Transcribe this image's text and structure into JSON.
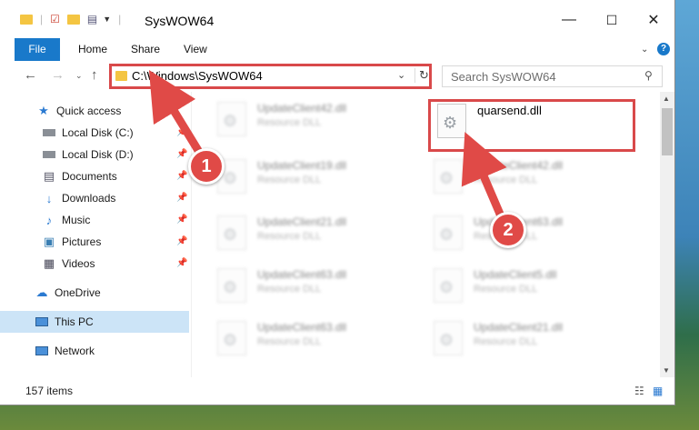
{
  "window": {
    "title": "SysWOW64",
    "caption": {
      "minimize": "—",
      "maximize": "☐",
      "close": "✕"
    }
  },
  "ribbon": {
    "tabs": [
      {
        "label": "File"
      },
      {
        "label": "Home"
      },
      {
        "label": "Share"
      },
      {
        "label": "View"
      }
    ],
    "help": "?"
  },
  "nav": {
    "address": "C:\\Windows\\SysWOW64",
    "search_placeholder": "Search SysWOW64"
  },
  "sidebar": {
    "items": [
      {
        "label": "Quick access",
        "icon": "star-icon",
        "pinned": false
      },
      {
        "label": "Local Disk (C:)",
        "icon": "drive-icon",
        "pinned": true
      },
      {
        "label": "Local Disk (D:)",
        "icon": "drive-icon",
        "pinned": true
      },
      {
        "label": "Documents",
        "icon": "documents-icon",
        "pinned": true
      },
      {
        "label": "Downloads",
        "icon": "download-icon",
        "pinned": true
      },
      {
        "label": "Music",
        "icon": "music-icon",
        "pinned": true
      },
      {
        "label": "Pictures",
        "icon": "pictures-icon",
        "pinned": true
      },
      {
        "label": "Videos",
        "icon": "videos-icon",
        "pinned": true
      },
      {
        "label": "OneDrive",
        "icon": "cloud-icon",
        "pinned": false
      },
      {
        "label": "This PC",
        "icon": "computer-icon",
        "pinned": false,
        "selected": true
      },
      {
        "label": "Network",
        "icon": "network-icon",
        "pinned": false
      }
    ]
  },
  "files": [
    {
      "name": "UpdateClient42.dll",
      "type": "Resource DLL"
    },
    {
      "name": "quarsend.dll",
      "type": ""
    },
    {
      "name": "UpdateClient19.dll",
      "type": "Resource DLL"
    },
    {
      "name": "UpdateClient42.dll",
      "type": "Resource DLL"
    },
    {
      "name": "UpdateClient21.dll",
      "type": "Resource DLL"
    },
    {
      "name": "UpdateClient63.dll",
      "type": "Resource DLL"
    },
    {
      "name": "UpdateClient63.dll",
      "type": "Resource DLL"
    },
    {
      "name": "UpdateClient5.dll",
      "type": "Resource DLL"
    },
    {
      "name": "UpdateClient63.dll",
      "type": "Resource DLL"
    },
    {
      "name": "UpdateClient21.dll",
      "type": "Resource DLL"
    }
  ],
  "status": {
    "items_count": "157 items"
  },
  "annotations": {
    "step1": "1",
    "step2": "2",
    "color": "#e04a47"
  }
}
